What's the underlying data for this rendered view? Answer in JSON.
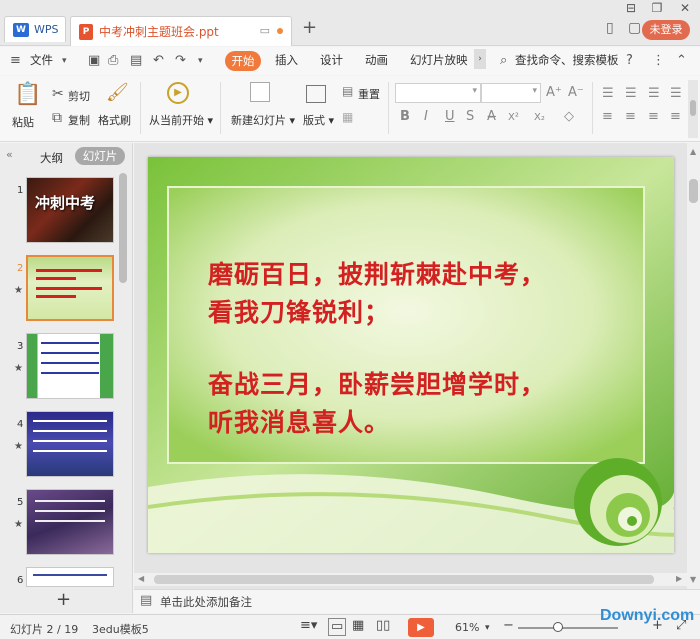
{
  "titlebar": {
    "app_tab": "WPS",
    "doc_tab": "中考冲刺主题班会.ppt",
    "new_tab": "+",
    "login": "未登录"
  },
  "menu": {
    "file": "文件",
    "items": [
      "开始",
      "插入",
      "设计",
      "动画",
      "幻灯片放映"
    ],
    "search": "查找命令、搜索模板"
  },
  "ribbon": {
    "paste": "粘贴",
    "cut": "剪切",
    "copy": "复制",
    "format_painter": "格式刷",
    "from_current": "从当前开始",
    "new_slide": "新建幻灯片",
    "layout": "版式",
    "reset": "重置"
  },
  "left_panel": {
    "outline_tab": "大纲",
    "slides_tab": "幻灯片",
    "thumb_numbers": [
      "1",
      "2",
      "3",
      "4",
      "5",
      "6"
    ],
    "thumb1_title": "冲刺中考",
    "add": "+"
  },
  "slide": {
    "line1": "磨砺百日，披荆斩棘赴中考，",
    "line2": "看我刀锋锐利；",
    "line3": "奋战三月，卧薪尝胆增学时，",
    "line4": "听我消息喜人。"
  },
  "notes": {
    "placeholder": "单击此处添加备注"
  },
  "status": {
    "slide_counter": "幻灯片 2 / 19",
    "template": "3edu模板5",
    "zoom": "61%",
    "watermark": "Downyi.com"
  },
  "colors": {
    "accent": "#f07a3b",
    "slide_text": "#d32020",
    "slide_bg": "#d9ecb4"
  }
}
